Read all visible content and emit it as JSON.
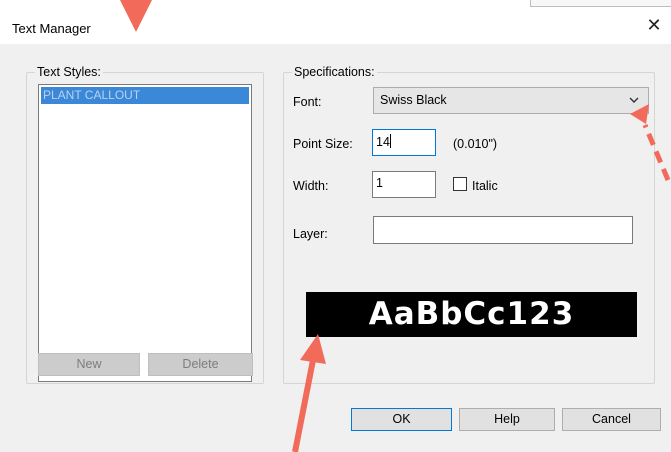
{
  "window": {
    "title": "Text Manager",
    "close_glyph": "✕"
  },
  "text_styles": {
    "group_label": "Text Styles:",
    "items": [
      "PLANT CALLOUT"
    ],
    "new_label": "New",
    "delete_label": "Delete"
  },
  "specifications": {
    "group_label": "Specifications:",
    "font_label": "Font:",
    "font_value": "Swiss Black",
    "point_size_label": "Point Size:",
    "point_size_value": "14",
    "point_size_inches": "(0.010\")",
    "width_label": "Width:",
    "width_value": "1",
    "italic_label": "Italic",
    "italic_checked": false,
    "layer_label": "Layer:",
    "layer_value": "",
    "preview_text": "AaBbCc123"
  },
  "footer": {
    "ok_label": "OK",
    "help_label": "Help",
    "cancel_label": "Cancel"
  },
  "colors": {
    "selection": "#3c88d8",
    "annotation_arrow": "#f26b5a",
    "preview_bg": "#000000",
    "preview_fg": "#ffffff"
  },
  "icons": {
    "close": "close-icon",
    "dropdown": "chevron-down-icon",
    "annotation": "arrow-annotation"
  }
}
